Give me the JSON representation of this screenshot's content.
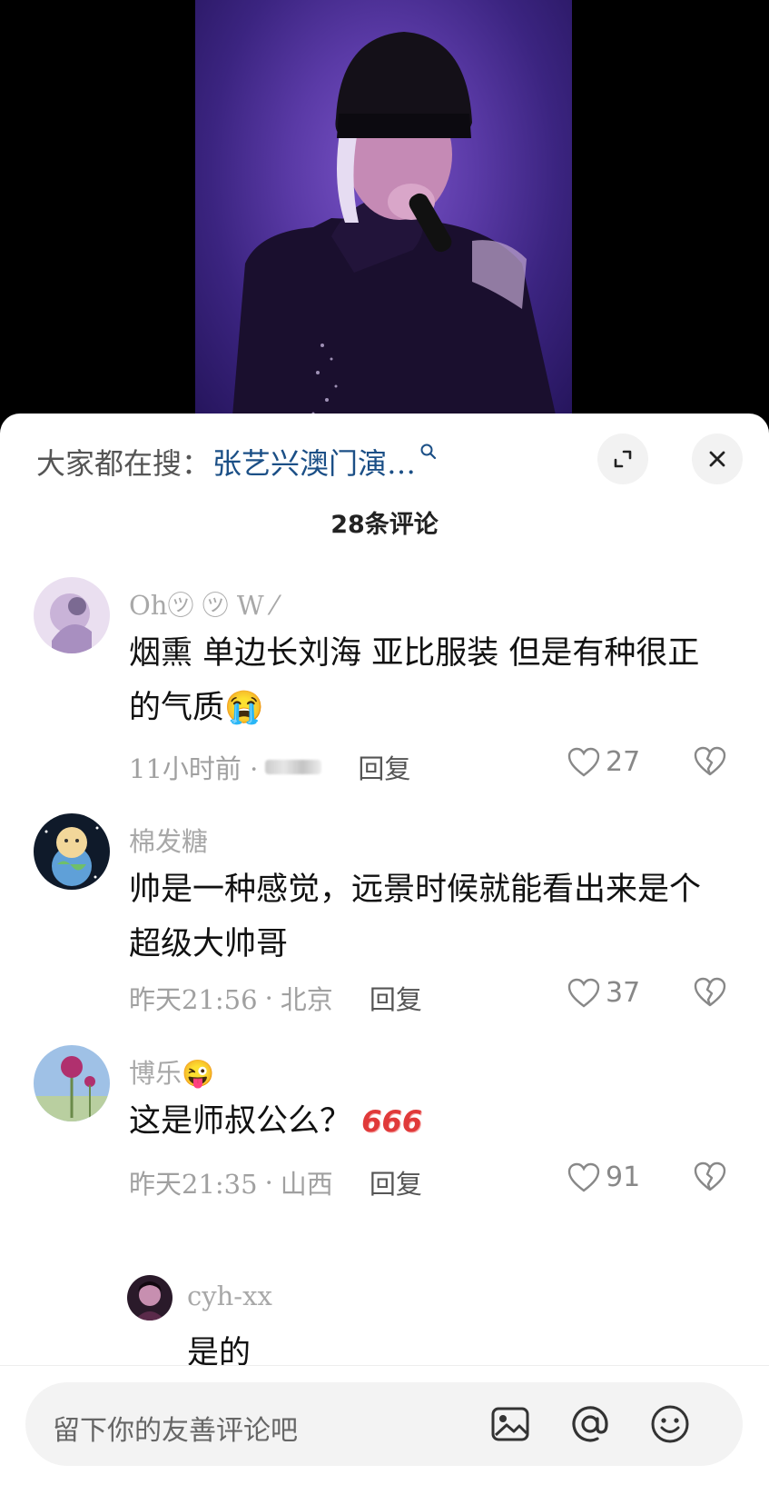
{
  "search": {
    "prefix": "大家都在搜：",
    "term": "张艺兴澳门演…",
    "mag_glyph": "ꟼ"
  },
  "header": {
    "comment_count": "28条评论"
  },
  "comments": [
    {
      "name": "Oh㋡ ㋡ W ⁄",
      "text": "烟熏 单边长刘海 亚比服装 但是有种很正的气质😭",
      "time": "11小时前 ·",
      "location": "",
      "reply": "回复",
      "likes": "27"
    },
    {
      "name": "棉发糖",
      "text": "帅是一种感觉，远景时候就能看出来是个超级大帅哥",
      "time": "昨天21:56",
      "location": "北京",
      "reply": "回复",
      "likes": "37"
    },
    {
      "name": "博乐😜",
      "text": "这是师叔公么？",
      "sticker": "666",
      "time": "昨天21:35",
      "location": "山西",
      "reply": "回复",
      "likes": "91"
    }
  ],
  "sub_reply": {
    "name": "cyh-xx",
    "text": "是的"
  },
  "input": {
    "placeholder": "留下你的友善评论吧"
  },
  "icons": {
    "expand": "expand-icon",
    "close": "close-icon",
    "like": "heart-icon",
    "dislike": "broken-heart-icon",
    "image": "image-icon",
    "mention": "at-icon",
    "emoji": "emoji-icon"
  },
  "colors": {
    "search_term": "#1b4f86",
    "video_bg": "#5a3aa6",
    "sticker": "#e03a3a"
  }
}
